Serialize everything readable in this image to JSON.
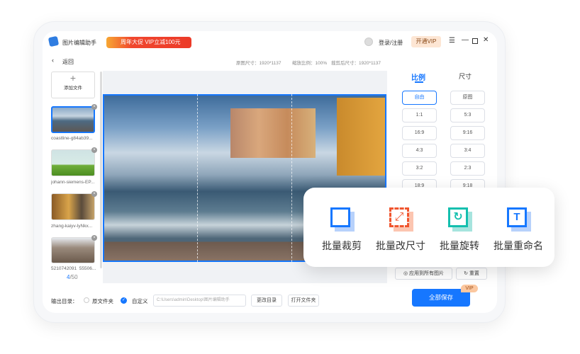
{
  "app": {
    "title": "图片编辑助手",
    "promo": "周年大促 VIP立减100元",
    "login": "登录/注册",
    "vip": "开通VIP"
  },
  "toolbar": {
    "back": "返回",
    "orig_size": "原图尺寸：1920*1137",
    "zoom": "缩放比例：100%",
    "crop_size": "裁剪后尺寸：1920*1137"
  },
  "sidebar": {
    "add": "添加文件",
    "files": [
      "coastline-g84ab39...",
      "johann-siemens-EP...",
      "zhang-kaiyv-lyNkx...",
      "5210742091_55506..."
    ],
    "page_current": "4",
    "page_total": "/50"
  },
  "panel": {
    "tabs": [
      "比例",
      "尺寸"
    ],
    "ratios": [
      "自由",
      "原图",
      "1:1",
      "5:3",
      "16:9",
      "9:16",
      "4:3",
      "3:4",
      "3:2",
      "2:3",
      "18:9",
      "9:18"
    ],
    "apply_all": "应用到所有图片",
    "reset": "重置"
  },
  "features": [
    {
      "label": "批量裁剪",
      "icon": "crop-icon"
    },
    {
      "label": "批量改尺寸",
      "icon": "resize-icon"
    },
    {
      "label": "批量旋转",
      "icon": "rotate-icon"
    },
    {
      "label": "批量重命名",
      "icon": "rename-icon"
    }
  ],
  "bottom": {
    "output_label": "输出目录：",
    "opt_orig": "原文件夹",
    "opt_custom": "自定义",
    "path": "C:\\Users\\admin\\Desktop\\图片编辑助手",
    "change": "更改目录",
    "open": "打开文件夹",
    "save": "全部保存",
    "vip_tag": "VIP"
  },
  "colors": {
    "accent": "#1677ff",
    "promo": "#ec3a28"
  }
}
